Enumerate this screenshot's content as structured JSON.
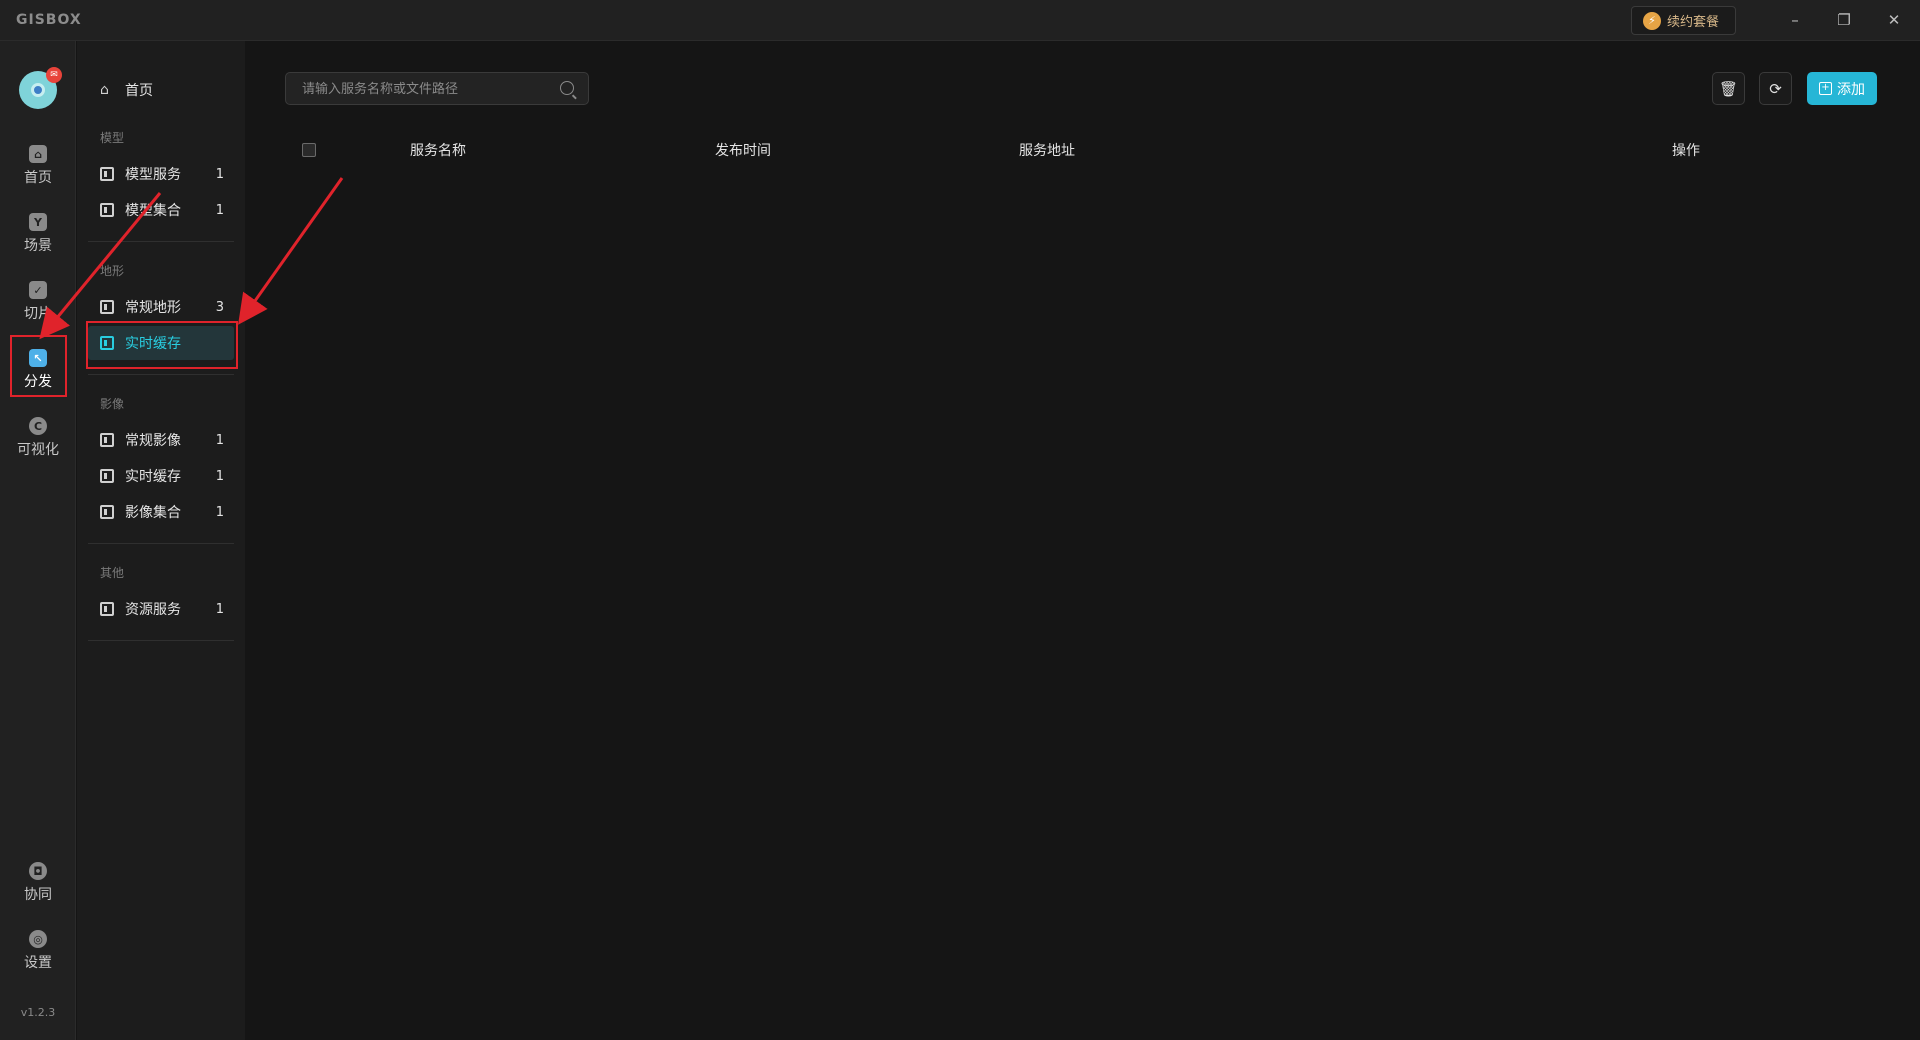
{
  "app": {
    "logo": "GISBOX"
  },
  "titlebar": {
    "renew_label": "续约套餐",
    "minimize": "–",
    "restore": "❐",
    "close": "✕"
  },
  "rail": {
    "items": [
      {
        "label": "首页",
        "icon": "home-icon",
        "glyph": "⌂"
      },
      {
        "label": "场景",
        "icon": "cube-icon",
        "glyph": "Y"
      },
      {
        "label": "切片",
        "icon": "slice-icon",
        "glyph": "✓"
      },
      {
        "label": "分发",
        "icon": "distribute-icon",
        "glyph": "↖"
      },
      {
        "label": "可视化",
        "icon": "visualize-icon",
        "glyph": "C"
      }
    ],
    "bottom": [
      {
        "label": "协同",
        "icon": "lock-icon",
        "glyph": "◘"
      },
      {
        "label": "设置",
        "icon": "settings-icon",
        "glyph": "◎"
      }
    ],
    "version": "v1.2.3",
    "avatar_badge": "✉"
  },
  "submenu": {
    "home": "首页",
    "sections": {
      "model": "模型",
      "terrain": "地形",
      "imagery": "影像",
      "other": "其他"
    },
    "model_items": [
      {
        "label": "模型服务",
        "count": "1"
      },
      {
        "label": "模型集合",
        "count": "1"
      }
    ],
    "terrain_items": [
      {
        "label": "常规地形",
        "count": "3"
      },
      {
        "label": "实时缓存",
        "count": ""
      }
    ],
    "imagery_items": [
      {
        "label": "常规影像",
        "count": "1"
      },
      {
        "label": "实时缓存",
        "count": "1"
      },
      {
        "label": "影像集合",
        "count": "1"
      }
    ],
    "other_items": [
      {
        "label": "资源服务",
        "count": "1"
      }
    ]
  },
  "main": {
    "search_placeholder": "请输入服务名称或文件路径",
    "add_label": "添加",
    "delete_glyph": "🗑",
    "refresh_glyph": "⟳",
    "columns": [
      "服务名称",
      "发布时间",
      "服务地址",
      "操作"
    ]
  },
  "colors": {
    "accent": "#26b6d6",
    "active_text": "#29cde0",
    "annotation": "#e0232b"
  }
}
